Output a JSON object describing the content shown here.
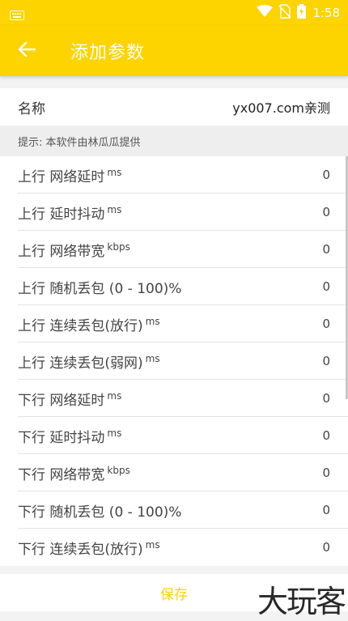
{
  "status_bar": {
    "time": "1:58",
    "icons": [
      "keyboard-icon",
      "wifi-icon",
      "no-sim-icon",
      "battery-charging-icon"
    ]
  },
  "app_bar": {
    "title": "添加参数",
    "back_icon": "arrow-left-icon"
  },
  "name_row": {
    "label": "名称",
    "value": "yx007.com亲测"
  },
  "hint": "提示: 本软件由林瓜瓜提供",
  "params": [
    {
      "label": "上行 网络延时",
      "unit": "ms",
      "value": "0"
    },
    {
      "label": "上行 延时抖动",
      "unit": "ms",
      "value": "0"
    },
    {
      "label": "上行 网络带宽",
      "unit": "kbps",
      "value": "0"
    },
    {
      "label": "上行 随机丢包 (0 - 100)%",
      "unit": "",
      "value": "0"
    },
    {
      "label": "上行 连续丢包(放行)",
      "unit": "ms",
      "value": "0"
    },
    {
      "label": "上行 连续丢包(弱网)",
      "unit": "ms",
      "value": "0"
    },
    {
      "label": "下行 网络延时",
      "unit": "ms",
      "value": "0"
    },
    {
      "label": "下行 延时抖动",
      "unit": "ms",
      "value": "0"
    },
    {
      "label": "下行 网络带宽",
      "unit": "kbps",
      "value": "0"
    },
    {
      "label": "下行 随机丢包 (0 - 100)%",
      "unit": "",
      "value": "0"
    },
    {
      "label": "下行 连续丢包(放行)",
      "unit": "ms",
      "value": "0"
    }
  ],
  "save_label": "保存",
  "watermark": "大玩客",
  "colors": {
    "accent": "#fdd300",
    "background": "#f3f3f3",
    "row_background": "#ffffff"
  }
}
